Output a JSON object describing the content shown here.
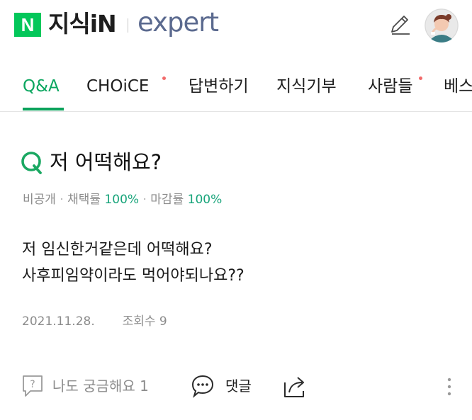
{
  "header": {
    "logo_badge": "N",
    "logo_text": "지식iN",
    "expert_text": "expert",
    "icons": {
      "write": "pencil-icon",
      "profile": "avatar"
    }
  },
  "tabs": [
    {
      "label": "Q&A",
      "active": true,
      "dot": false
    },
    {
      "label": "CHOiCE",
      "active": false,
      "dot": true
    },
    {
      "label": "답변하기",
      "active": false,
      "dot": false
    },
    {
      "label": "지식기부",
      "active": false,
      "dot": false
    },
    {
      "label": "사람들",
      "active": false,
      "dot": true
    },
    {
      "label": "베스",
      "active": false,
      "dot": false
    }
  ],
  "question": {
    "title": "저 어떡해요?",
    "meta": {
      "privacy": "비공개",
      "adopt_label": "채택률",
      "adopt_value": "100%",
      "close_label": "마감률",
      "close_value": "100%"
    },
    "body": [
      "저 임신한거같은데 어떡해요?",
      "사후피임약이라도 먹어야되나요??"
    ],
    "date": "2021.11.28.",
    "views": "조회수 9"
  },
  "actions": {
    "curious_label": "나도 궁금해요 1",
    "comment_label": "댓글"
  },
  "colors": {
    "accent_green": "#0aa65f",
    "naver_green": "#03c75a",
    "expert_blue": "#5b6a8f",
    "notification_dot": "#f26a6a"
  }
}
